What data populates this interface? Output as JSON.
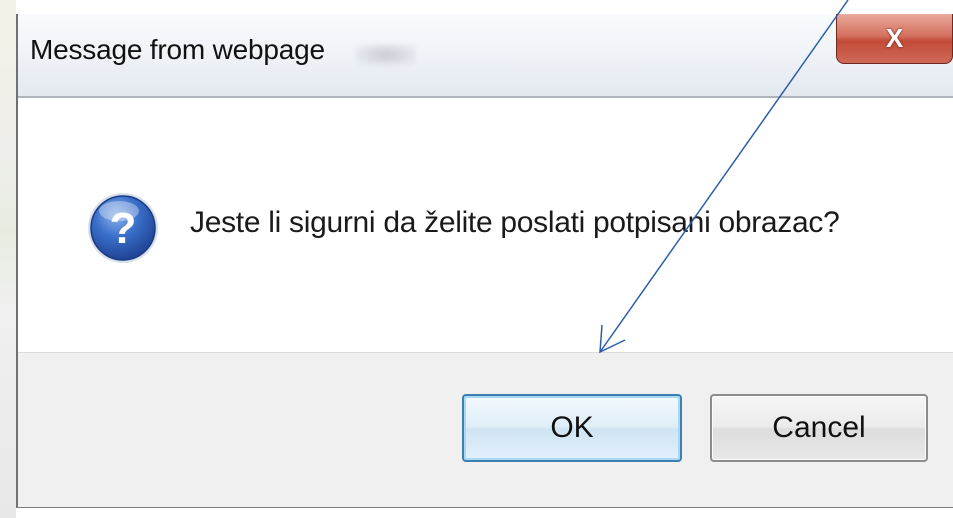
{
  "dialog": {
    "title": "Message from webpage",
    "close_label": "X",
    "message": "Jeste li sigurni da želite poslati potpisani obrazac?",
    "icon": "question-icon"
  },
  "buttons": {
    "ok_label": "OK",
    "cancel_label": "Cancel"
  },
  "colors": {
    "close_button": "#c24a37",
    "ok_border": "#3c7fb1",
    "footer_background": "#f0f0f0",
    "annotation_arrow": "#2b5fa8"
  }
}
